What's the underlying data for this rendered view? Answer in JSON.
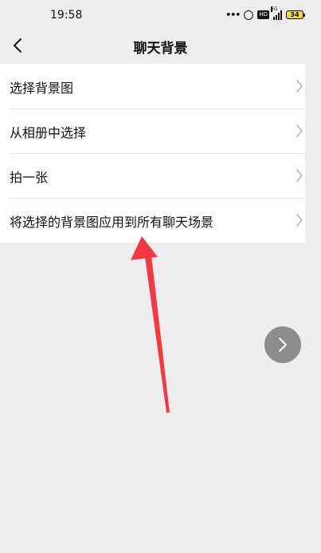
{
  "status_bar": {
    "time": "19:58",
    "dots": "•••",
    "hd": "HD",
    "network": "5G",
    "battery": "34"
  },
  "nav": {
    "title": "聊天背景",
    "back_icon": "chevron-left-icon"
  },
  "menu": {
    "items": [
      {
        "label": "选择背景图"
      },
      {
        "label": "从相册中选择"
      },
      {
        "label": "拍一张"
      },
      {
        "label": "将选择的背景图应用到所有聊天场景"
      }
    ]
  },
  "floating_button": {
    "icon": "chevron-right-icon"
  },
  "annotation": {
    "color": "#f03a43"
  },
  "colors": {
    "background": "#ededed",
    "list_bg": "#ffffff",
    "float_button": "#8d8d8d"
  }
}
